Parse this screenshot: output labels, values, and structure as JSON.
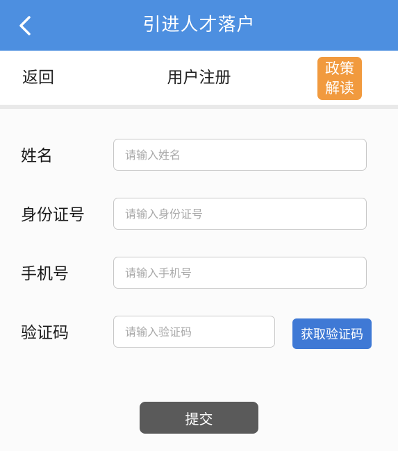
{
  "topbar": {
    "title": "引进人才落户",
    "back_icon": "chevron-left-icon"
  },
  "subheader": {
    "back_label": "返回",
    "title": "用户注册",
    "policy_badge": {
      "line1": "政策",
      "line2": "解读",
      "color": "#f19a3e"
    }
  },
  "form": {
    "name": {
      "label": "姓名",
      "placeholder": "请输入姓名",
      "value": ""
    },
    "id_number": {
      "label": "身份证号",
      "placeholder": "请输入身份证号",
      "value": ""
    },
    "phone": {
      "label": "手机号",
      "placeholder": "请输入手机号",
      "value": ""
    },
    "code": {
      "label": "验证码",
      "placeholder": "请输入验证码",
      "value": ""
    },
    "get_code_label": "获取验证码",
    "submit_label": "提交"
  },
  "colors": {
    "topbar": "#4d8fe0",
    "code_button": "#3f79d5",
    "submit_button": "#5a5a5a"
  }
}
